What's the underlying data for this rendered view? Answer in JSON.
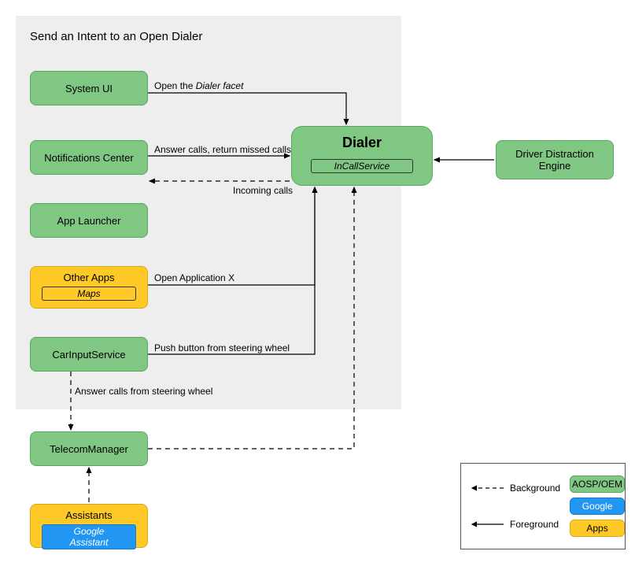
{
  "container": {
    "title": "Send an Intent to an Open Dialer"
  },
  "nodes": {
    "system_ui": "System UI",
    "notifications": "Notifications Center",
    "app_launcher": "App Launcher",
    "other_apps": {
      "title": "Other Apps",
      "sub": "Maps"
    },
    "car_input": "CarInputService",
    "telecom": "TelecomManager",
    "assistants": {
      "title": "Assistants",
      "sub": "Google Assistant"
    },
    "dialer": {
      "title": "Dialer",
      "sub": "InCallService"
    },
    "dde": "Driver Distraction Engine"
  },
  "edges": {
    "open_facet_pre": "Open the ",
    "open_facet_em": "Dialer facet",
    "answer_missed": "Answer calls, return missed calls",
    "incoming": "Incoming calls",
    "open_app_x": "Open Application X",
    "push_button": "Push button from steering wheel",
    "answer_steering": "Answer calls from steering wheel"
  },
  "legend": {
    "background": "Background",
    "foreground": "Foreground",
    "aosp": "AOSP/OEM",
    "google": "Google",
    "apps": "Apps"
  }
}
